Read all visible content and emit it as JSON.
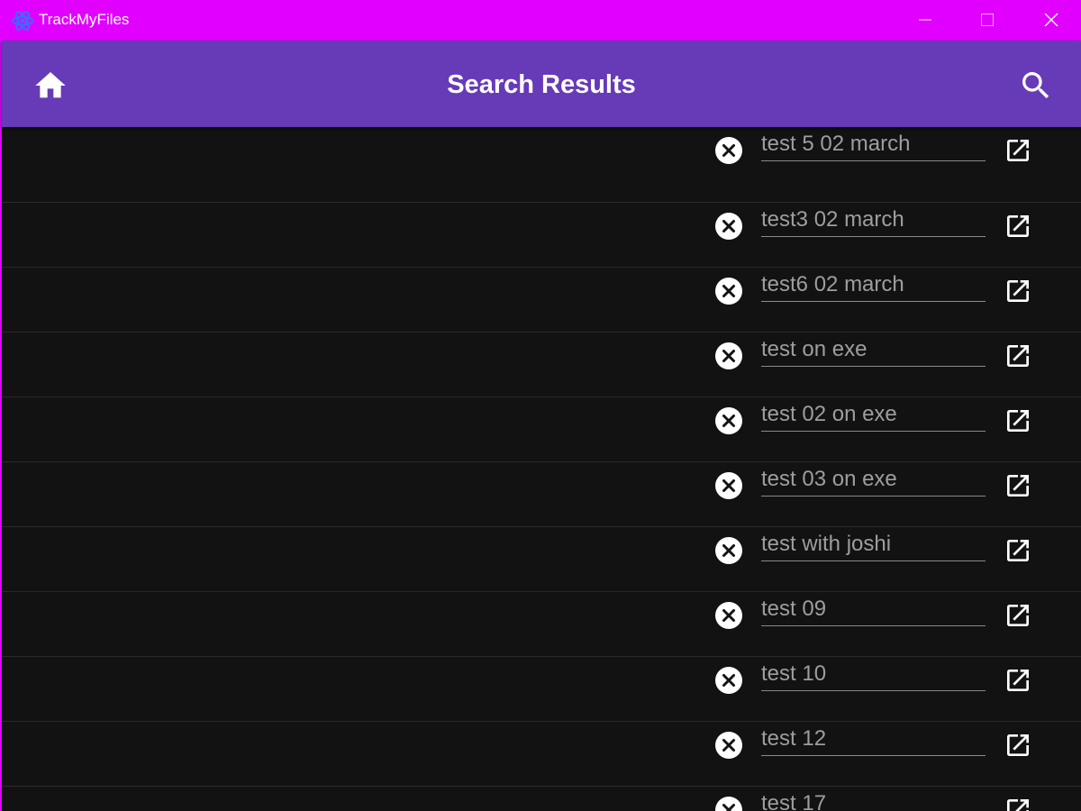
{
  "window": {
    "title": "TrackMyFiles",
    "icons": {
      "app": "atom-icon",
      "minimize": "minimize-icon",
      "maximize": "maximize-icon",
      "close": "close-icon"
    },
    "colors": {
      "titlebar": "#e100ff",
      "appbar": "#673ab7",
      "background": "#121212"
    }
  },
  "appbar": {
    "title": "Search Results",
    "home_icon": "home-icon",
    "search_icon": "search-icon"
  },
  "results": [
    {
      "name": "test 5 02 march"
    },
    {
      "name": "test3 02 march"
    },
    {
      "name": "test6 02 march"
    },
    {
      "name": "test on exe"
    },
    {
      "name": "test 02 on exe"
    },
    {
      "name": "test 03 on exe"
    },
    {
      "name": "test with joshi"
    },
    {
      "name": "test 09"
    },
    {
      "name": "test 10"
    },
    {
      "name": "test 12"
    },
    {
      "name": "test 17"
    }
  ],
  "row_icons": {
    "remove": "cancel-circle-icon",
    "open": "open-in-new-icon"
  }
}
